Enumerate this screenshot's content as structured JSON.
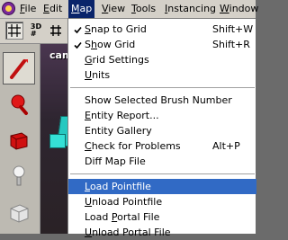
{
  "menubar": {
    "items": [
      {
        "label": "File",
        "mnemonic_index": 0
      },
      {
        "label": "Edit",
        "mnemonic_index": 0
      },
      {
        "label": "Map",
        "mnemonic_index": 0
      },
      {
        "label": "View",
        "mnemonic_index": 0
      },
      {
        "label": "Tools",
        "mnemonic_index": 0
      },
      {
        "label": "Instancing",
        "mnemonic_index": 0
      },
      {
        "label": "Window",
        "mnemonic_index": 0
      }
    ],
    "active": "Map"
  },
  "toolbar": {
    "buttons": [
      {
        "icon": "snap-grid-icon",
        "pressed": true
      },
      {
        "icon": "3d-grid-icon",
        "glyph": "3D",
        "pressed": false
      },
      {
        "icon": "grid-icon",
        "pressed": false
      }
    ]
  },
  "palette": {
    "tools": [
      {
        "icon": "selection-tool-icon",
        "selected": true
      },
      {
        "icon": "magnify-tool-icon",
        "selected": false
      },
      {
        "icon": "camera-tool-icon",
        "selected": false
      },
      {
        "icon": "entity-tool-icon",
        "selected": false
      },
      {
        "icon": "block-tool-icon",
        "selected": false
      }
    ]
  },
  "viewport": {
    "label": "cam"
  },
  "map_menu": {
    "items": [
      {
        "type": "item",
        "label": "Snap to Grid",
        "checked": true,
        "shortcut": "Shift+W",
        "mnemonic": "S"
      },
      {
        "type": "item",
        "label": "Show Grid",
        "checked": true,
        "shortcut": "Shift+R",
        "mnemonic": "h"
      },
      {
        "type": "item",
        "label": "Grid Settings",
        "checked": false,
        "shortcut": "",
        "mnemonic": "G"
      },
      {
        "type": "item",
        "label": "Units",
        "checked": false,
        "shortcut": "",
        "mnemonic": "U"
      },
      {
        "type": "separator"
      },
      {
        "type": "item",
        "label": "Show Selected Brush Number",
        "checked": false,
        "shortcut": "",
        "mnemonic": ""
      },
      {
        "type": "item",
        "label": "Entity Report...",
        "checked": false,
        "shortcut": "",
        "mnemonic": "E"
      },
      {
        "type": "item",
        "label": "Entity Gallery",
        "checked": false,
        "shortcut": "",
        "mnemonic": ""
      },
      {
        "type": "item",
        "label": "Check for Problems",
        "checked": false,
        "shortcut": "Alt+P",
        "mnemonic": "C"
      },
      {
        "type": "item",
        "label": "Diff Map File",
        "checked": false,
        "shortcut": "",
        "mnemonic": ""
      },
      {
        "type": "separator"
      },
      {
        "type": "item",
        "label": "Load Pointfile",
        "checked": false,
        "shortcut": "",
        "mnemonic": "L",
        "highlighted": true
      },
      {
        "type": "item",
        "label": "Unload Pointfile",
        "checked": false,
        "shortcut": "",
        "mnemonic": "U"
      },
      {
        "type": "item",
        "label": "Load Portal File",
        "checked": false,
        "shortcut": "",
        "mnemonic": "P"
      },
      {
        "type": "item",
        "label": "Unload Portal File",
        "checked": false,
        "shortcut": "",
        "mnemonic": "U"
      }
    ]
  },
  "colors": {
    "menu_highlight": "#316ac5",
    "active_menu": "#0a246a",
    "chrome": "#d4d0c8"
  }
}
